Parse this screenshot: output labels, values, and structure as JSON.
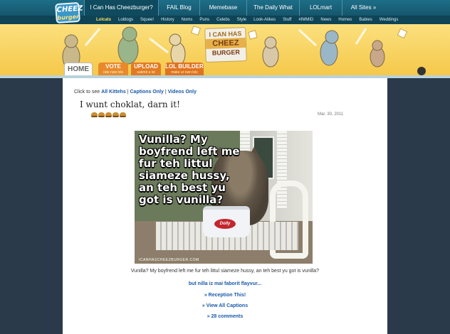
{
  "logo": {
    "line1": "CHEEZ",
    "line2": "burger"
  },
  "topnav": {
    "tabs": [
      {
        "label": "I Can Has Cheezburger?"
      },
      {
        "label": "FAIL Blog"
      },
      {
        "label": "Memebase"
      },
      {
        "label": "The Daily What"
      },
      {
        "label": "LOLmart"
      },
      {
        "label": "All Sites »"
      }
    ]
  },
  "subnav": {
    "items": [
      "Lolcats",
      "Loldogs",
      "Squee!",
      "History",
      "Noms",
      "Puns",
      "Celebs",
      "Style",
      "Look-Alikes",
      "Stuff",
      "#IMMID",
      "News",
      "Homes",
      "Babies",
      "Weddings"
    ]
  },
  "banner": {
    "logo_line1": "I CAN HAS",
    "logo_line2": "CHEEZ",
    "logo_line3": "BURGER"
  },
  "mainnav": {
    "home": "HOME",
    "vote": {
      "title": "VOTE",
      "sub": "rate new lols"
    },
    "upload": {
      "title": "UPLOAD",
      "sub": "submit a lol"
    },
    "lolbuilder": {
      "title": "LOL BUILDER",
      "sub": "make ur own lolz"
    }
  },
  "filter": {
    "prefix": "Click to see",
    "all": "All Kittehs",
    "sep1": "|",
    "captions": "Captions Only",
    "sep2": "|",
    "videos": "Videos Only"
  },
  "post": {
    "title": "I wunt choklat, darn it!",
    "rating_burgers": 5,
    "date": "Mar. 30, 2011",
    "image_caption": "Vunilla? My boyfrend left me fur teh littul siameze hussy, an teh best yu got is vunilla?",
    "image_watermark": "ICANHASCHEEZBURGER.COM",
    "tub_label": "Dolly",
    "description": "Vunilla? My boyfrend left me fur teh littul siameze hussy, an teh best yu got is vunilla?",
    "sublink": "but nilla iz mai faborit flayvur...",
    "links": {
      "reception": "» Reception This!",
      "captions": "» View All Captions",
      "comments": "» 28 comments"
    }
  },
  "colors": {
    "nav_bg": "#15566c",
    "banner": "#f5c84a",
    "link": "#1a5aa8",
    "page_bg": "#2a3a4a"
  }
}
